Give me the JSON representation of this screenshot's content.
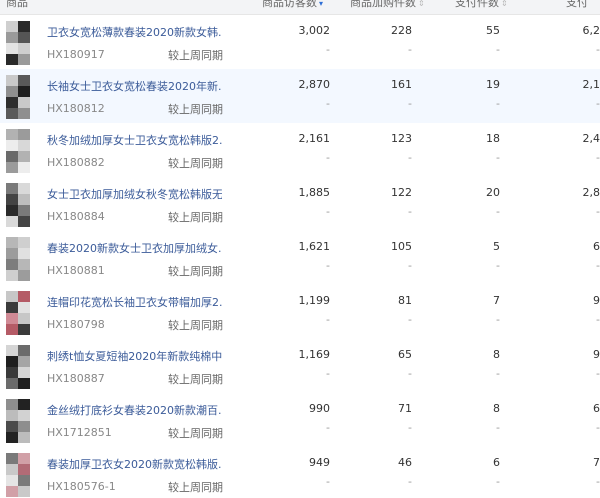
{
  "header": {
    "product": "商品",
    "visits": "商品访客数",
    "cart": "商品加购件数",
    "paid_items": "支付件数",
    "paid_x": "支付"
  },
  "compare_label": "较上周同期",
  "rows": [
    {
      "name": "卫衣女宽松薄款春装2020新款女韩...",
      "code": "HX180917",
      "visits": "3,002",
      "cart": "228",
      "paid_items": "55",
      "paid_x": "6,2",
      "dash": "-"
    },
    {
      "name": "长袖女士卫衣女宽松春装2020年新...",
      "code": "HX180812",
      "visits": "2,870",
      "cart": "161",
      "paid_items": "19",
      "paid_x": "2,1",
      "dash": "-"
    },
    {
      "name": "秋冬加绒加厚女士卫衣女宽松韩版2...",
      "code": "HX180882",
      "visits": "2,161",
      "cart": "123",
      "paid_items": "18",
      "paid_x": "2,4",
      "dash": "-"
    },
    {
      "name": "女士卫衣加厚加绒女秋冬宽松韩版无...",
      "code": "HX180884",
      "visits": "1,885",
      "cart": "122",
      "paid_items": "20",
      "paid_x": "2,8",
      "dash": "-"
    },
    {
      "name": "春装2020新款女士卫衣加厚加绒女...",
      "code": "HX180881",
      "visits": "1,621",
      "cart": "105",
      "paid_items": "5",
      "paid_x": "6",
      "dash": "-"
    },
    {
      "name": "连帽印花宽松长袖卫衣女带帽加厚2...",
      "code": "HX180798",
      "visits": "1,199",
      "cart": "81",
      "paid_items": "7",
      "paid_x": "9",
      "dash": "-"
    },
    {
      "name": "刺绣t恤女夏短袖2020年新款纯棉中...",
      "code": "HX180887",
      "visits": "1,169",
      "cart": "65",
      "paid_items": "8",
      "paid_x": "9",
      "dash": "-"
    },
    {
      "name": "金丝绒打底衫女春装2020新款潮百...",
      "code": "HX1712851",
      "visits": "990",
      "cart": "71",
      "paid_items": "8",
      "paid_x": "6",
      "dash": "-"
    },
    {
      "name": "春装加厚卫衣女2020新款宽松韩版...",
      "code": "HX180576-1",
      "visits": "949",
      "cart": "46",
      "paid_items": "6",
      "paid_x": "7",
      "dash": "-"
    }
  ],
  "colors": {
    "header_bg": "#f3f4f6",
    "link": "#3b5b99",
    "highlight_row": "#f3f8ff",
    "sort_active": "#2f6fd6"
  }
}
